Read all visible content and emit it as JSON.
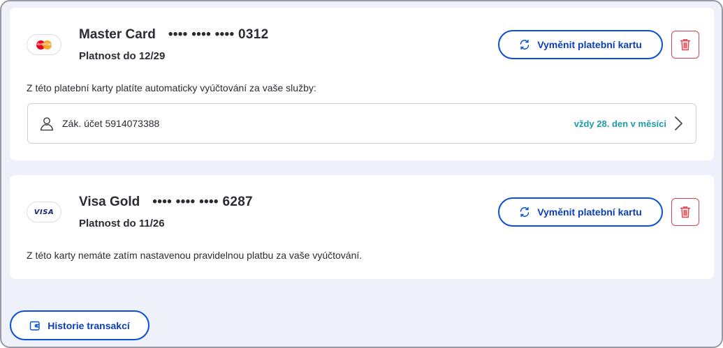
{
  "colors": {
    "accent": "#0a4fd6",
    "accent_text": "#0a3fb5",
    "danger": "#e0434c",
    "schedule": "#1f9aa8",
    "background": "#eef1f9"
  },
  "cards": [
    {
      "brand_icon": "mastercard-logo",
      "brand_logo_text": "MasterCard",
      "name": "Master Card",
      "number": "•••• •••• •••• 0312",
      "validity": "Platnost do 12/29",
      "replace_label": "Vyměnit platební kartu",
      "replace_icon": "refresh-icon",
      "delete_icon": "trash-icon",
      "info": "Z této platební karty platíte automaticky vyúčtování za vaše služby:",
      "account": {
        "icon": "person-icon",
        "label": "Zák. účet 5914073388",
        "schedule": "vždy 28. den v měsíci",
        "chevron_icon": "chevron-right-icon"
      }
    },
    {
      "brand_icon": "visa-logo",
      "brand_logo_text": "VISA",
      "name": "Visa Gold",
      "number": "•••• •••• •••• 6287",
      "validity": "Platnost do 11/26",
      "replace_label": "Vyměnit platební kartu",
      "replace_icon": "refresh-icon",
      "delete_icon": "trash-icon",
      "info": "Z této karty nemáte zatím nastavenou pravidelnou platbu za vaše vyúčtování."
    }
  ],
  "footer": {
    "history_label": "Historie transakcí",
    "history_icon": "wallet-icon"
  }
}
